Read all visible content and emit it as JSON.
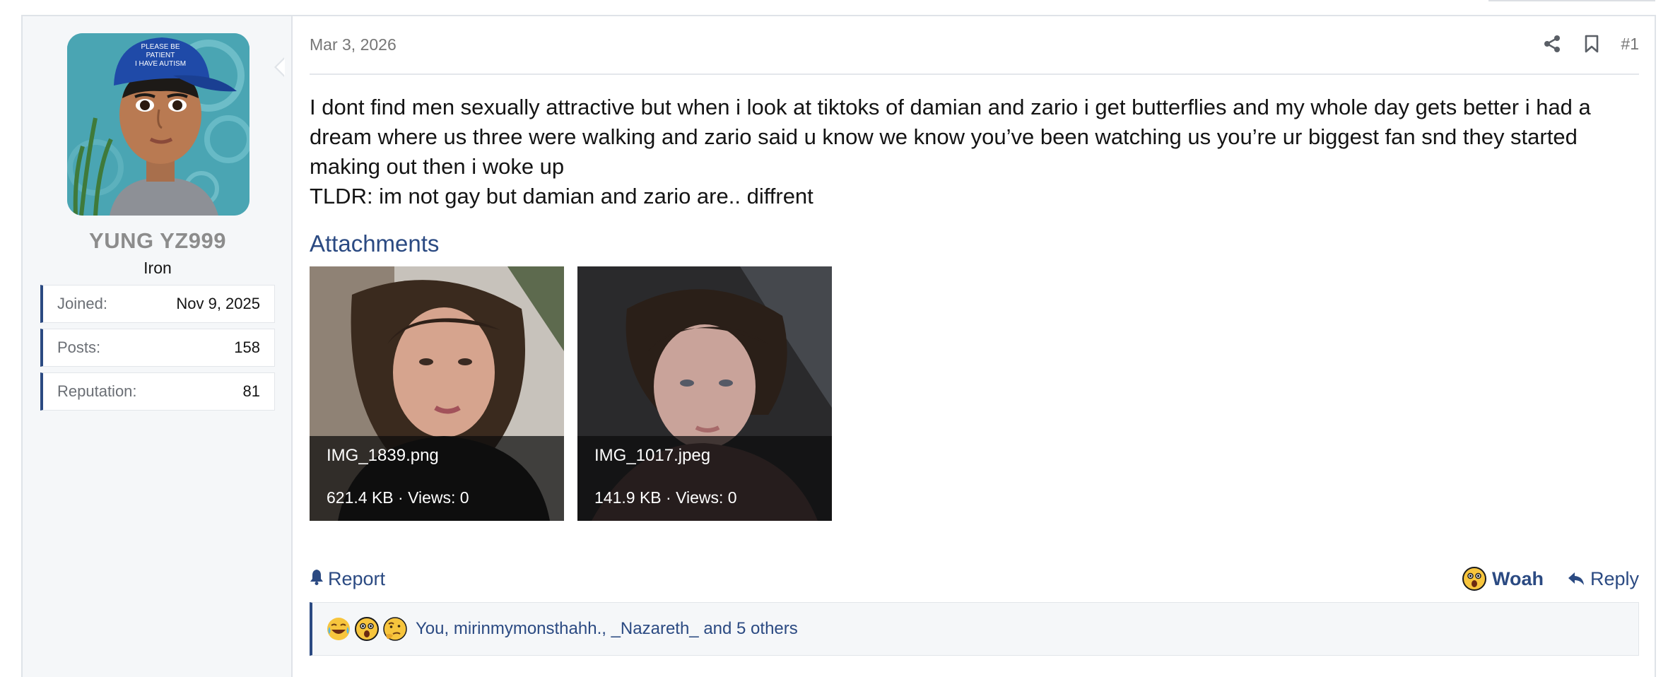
{
  "user": {
    "username": "YUNG YZ999",
    "title": "Iron",
    "avatar_cap_text": "PLEASE BE PATIENT I HAVE AUTISM",
    "stats": [
      {
        "label": "Joined:",
        "value": "Nov 9, 2025"
      },
      {
        "label": "Posts:",
        "value": "158"
      },
      {
        "label": "Reputation:",
        "value": "81"
      }
    ]
  },
  "post": {
    "date": "Mar 3, 2026",
    "number": "#1",
    "body_lines": [
      "I dont find men sexually attractive but when i look at tiktoks of damian and zario i get butterflies and my whole day gets better i had a dream where us three were walking and zario said u know we know you’ve been watching us you’re ur biggest fan snd they started making out then i woke up",
      "TLDR: im not gay but damian and zario are.. diffrent"
    ],
    "attachments_title": "Attachments",
    "attachments": [
      {
        "filename": "IMG_1839.png",
        "meta": "621.4 KB · Views: 0"
      },
      {
        "filename": "IMG_1017.jpeg",
        "meta": "141.9 KB · Views: 0"
      }
    ]
  },
  "actions": {
    "report_label": "Report",
    "reaction_label": "Woah",
    "reply_label": "Reply",
    "share_icon": "share-icon",
    "bookmark_icon": "bookmark-icon"
  },
  "reactions": {
    "icons": [
      "crying-laughing-emoji",
      "astonished-emoji",
      "thinking-emoji"
    ],
    "text": "You, mirinmymonsthahh., _Nazareth_ and 5 others"
  },
  "colors": {
    "accent": "#2b4a82",
    "sidebar_bg": "#f5f7f9",
    "border": "#dfe3e8"
  }
}
